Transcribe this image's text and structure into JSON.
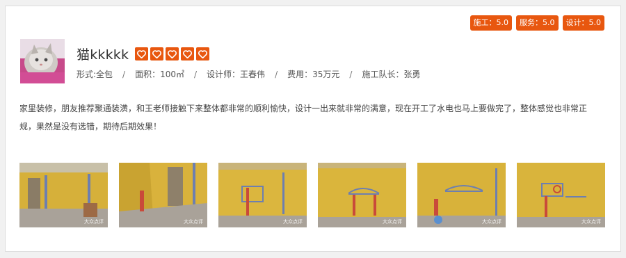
{
  "scores": [
    {
      "label": "施工：5.0"
    },
    {
      "label": "服务：5.0"
    },
    {
      "label": "设计：5.0"
    }
  ],
  "user": {
    "name": "猫kkkkk",
    "avatar_icon": "cat-avatar",
    "rating_icons": [
      "heart-icon",
      "heart-icon",
      "heart-icon",
      "heart-icon",
      "heart-icon"
    ]
  },
  "meta": [
    {
      "text": "形式:全包"
    },
    {
      "text": "面积：100㎡"
    },
    {
      "text": "设计师：王春伟"
    },
    {
      "text": "费用：35万元"
    },
    {
      "text": "施工队长：张勇"
    }
  ],
  "comment": "家里装修，朋友推荐聚通装潢，和王老师接触下来整体都非常的顺利愉快，设计一出来就非常的满意，现在开工了水电也马上要做完了，整体感觉也非常正规，果然是没有选错，期待后期效果！",
  "photos": [
    {
      "watermark": "大众点评"
    },
    {
      "watermark": "大众点评"
    },
    {
      "watermark": "大众点评"
    },
    {
      "watermark": "大众点评"
    },
    {
      "watermark": "大众点评"
    },
    {
      "watermark": "大众点评"
    }
  ],
  "colors": {
    "accent": "#e8570f",
    "wall": "#d9b53c"
  }
}
